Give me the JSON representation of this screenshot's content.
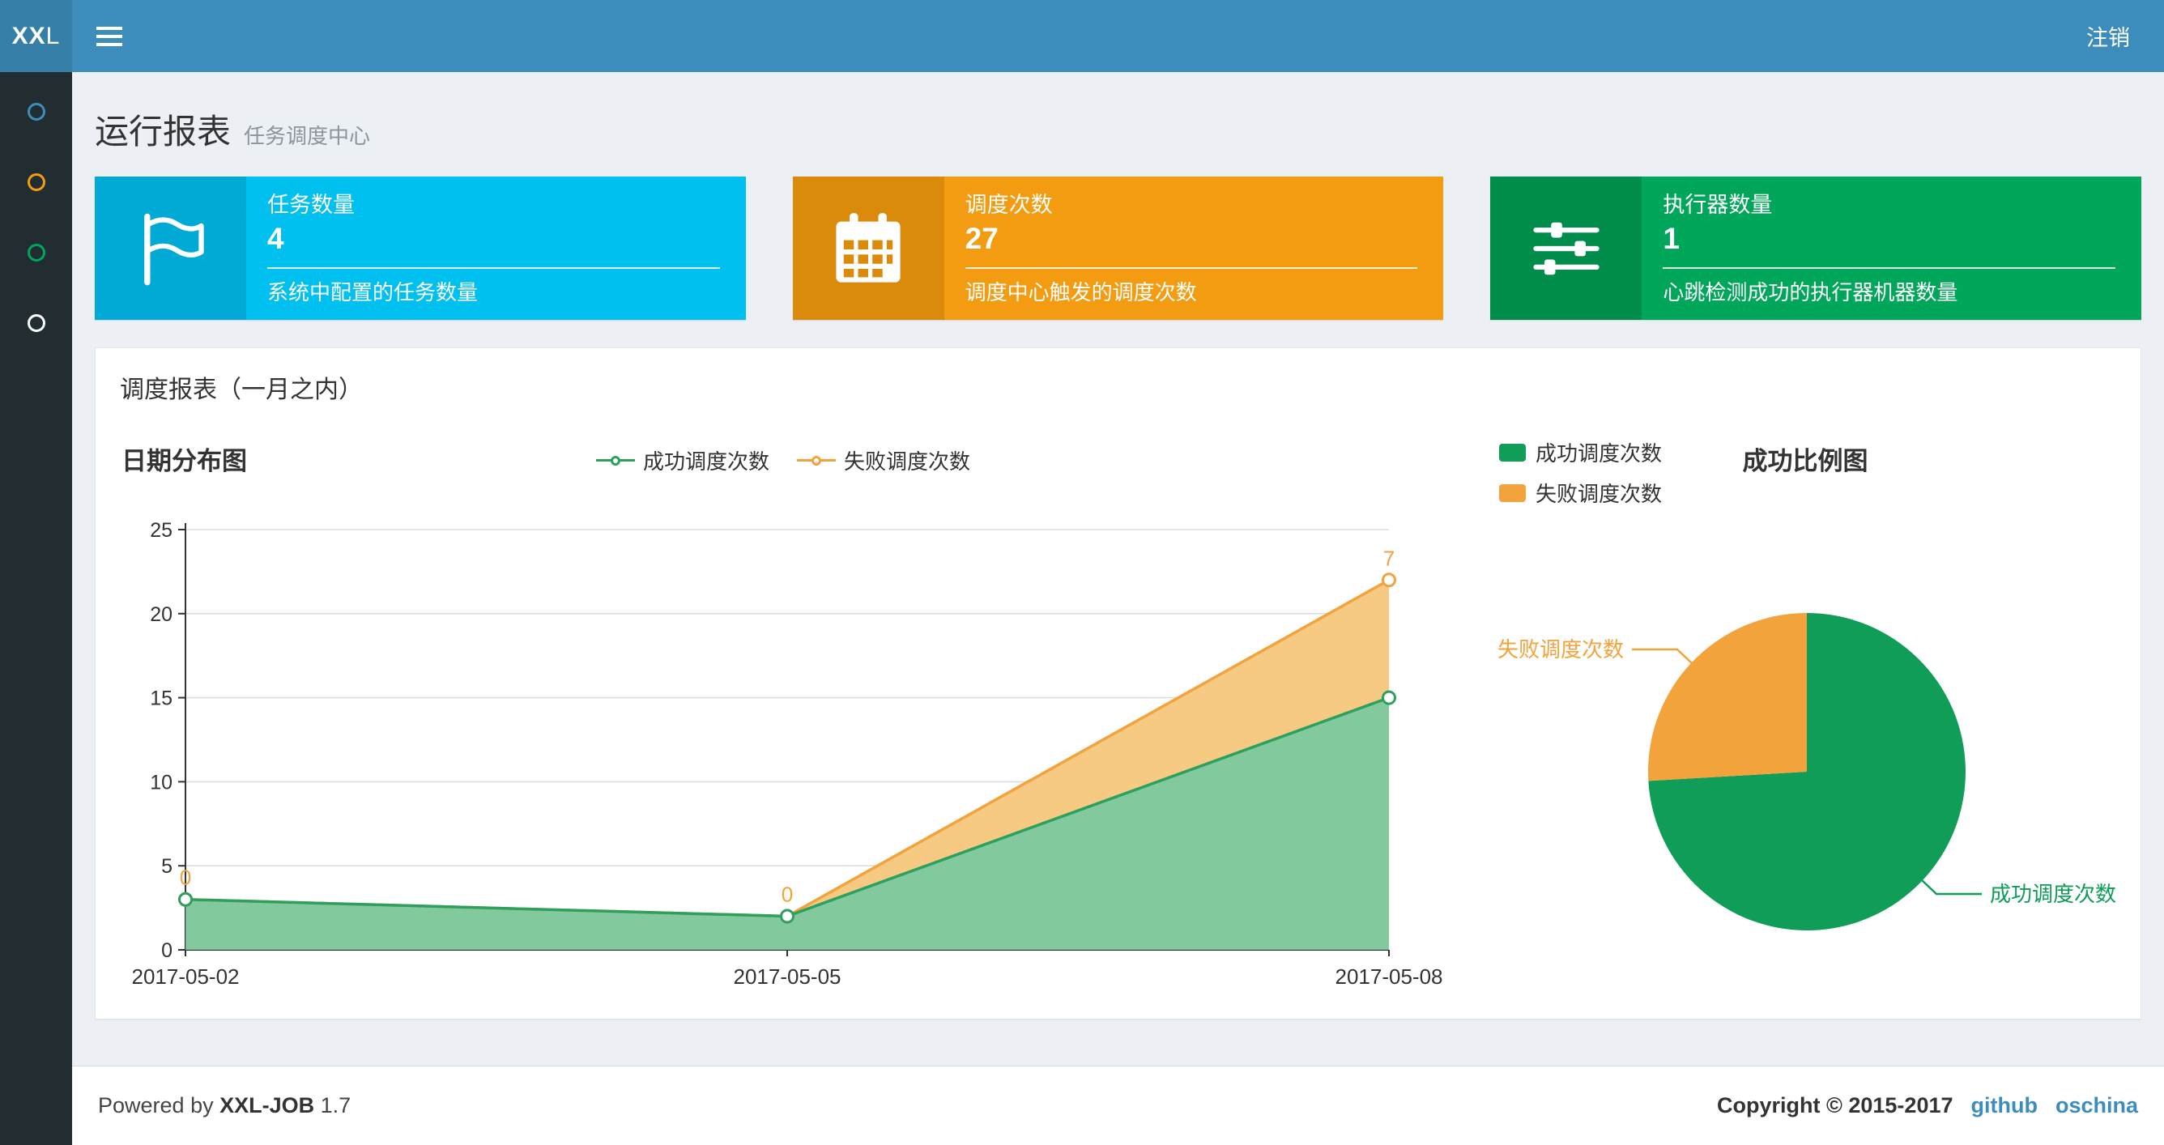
{
  "navbar": {
    "logo_bold": "XX",
    "logo_light": "L",
    "logout": "注销"
  },
  "theme": {
    "navbar_bg": "#3c8dbc",
    "logo_bg": "#367fa9",
    "sidebar_bg": "#222d32",
    "content_bg": "#ecf0f5"
  },
  "sidebar": {
    "items": [
      {
        "icon": "circle-icon",
        "color": "#3c8dbc"
      },
      {
        "icon": "circle-icon",
        "color": "#f39c12"
      },
      {
        "icon": "circle-icon",
        "color": "#00a65a"
      },
      {
        "icon": "circle-icon",
        "color": "#ffffff"
      }
    ]
  },
  "header": {
    "title": "运行报表",
    "subtitle": "任务调度中心"
  },
  "info_boxes": [
    {
      "title": "任务数量",
      "value": "4",
      "description": "系统中配置的任务数量",
      "icon": "flag-icon",
      "bg": "#00c0ef",
      "icon_bg": "#00aad4"
    },
    {
      "title": "调度次数",
      "value": "27",
      "description": "调度中心触发的调度次数",
      "icon": "calendar-icon",
      "bg": "#f39c12",
      "icon_bg": "#db8b0b"
    },
    {
      "title": "执行器数量",
      "value": "1",
      "description": "心跳检测成功的执行器机器数量",
      "icon": "sliders-icon",
      "bg": "#00a65a",
      "icon_bg": "#008d4c"
    }
  ],
  "panel": {
    "title": "调度报表（一月之内）"
  },
  "chart_data": [
    {
      "type": "area",
      "title": "日期分布图",
      "x": [
        "2017-05-02",
        "2017-05-05",
        "2017-05-08"
      ],
      "series": [
        {
          "name": "成功调度次数",
          "values": [
            3,
            2,
            15
          ],
          "color": "#2da05f",
          "fill": "#74c493"
        },
        {
          "name": "失败调度次数",
          "values": [
            0,
            0,
            7
          ],
          "color": "#f2a33c",
          "fill": "#f6c477",
          "stacked_on_previous": true
        }
      ],
      "stacked": true,
      "point_labels_series": "失败调度次数",
      "point_labels": [
        "0",
        "0",
        "7"
      ],
      "ylim": [
        0,
        25
      ],
      "yticks": [
        0,
        5,
        10,
        15,
        20,
        25
      ],
      "grid": true,
      "legend_position": "top-center",
      "xlabel": "",
      "ylabel": ""
    },
    {
      "type": "pie",
      "title": "成功比例图",
      "labels": [
        "成功调度次数",
        "失败调度次数"
      ],
      "values": [
        20,
        7
      ],
      "colors": [
        "#0f9d58",
        "#f2a33c"
      ],
      "legend_position": "top-left",
      "start_angle": "top",
      "direction": "clockwise"
    }
  ],
  "footer": {
    "powered_by": "Powered by",
    "product": "XXL-JOB",
    "version": "1.7",
    "copyright": "Copyright © 2015-2017",
    "links": [
      {
        "label": "github"
      },
      {
        "label": "oschina"
      }
    ]
  }
}
